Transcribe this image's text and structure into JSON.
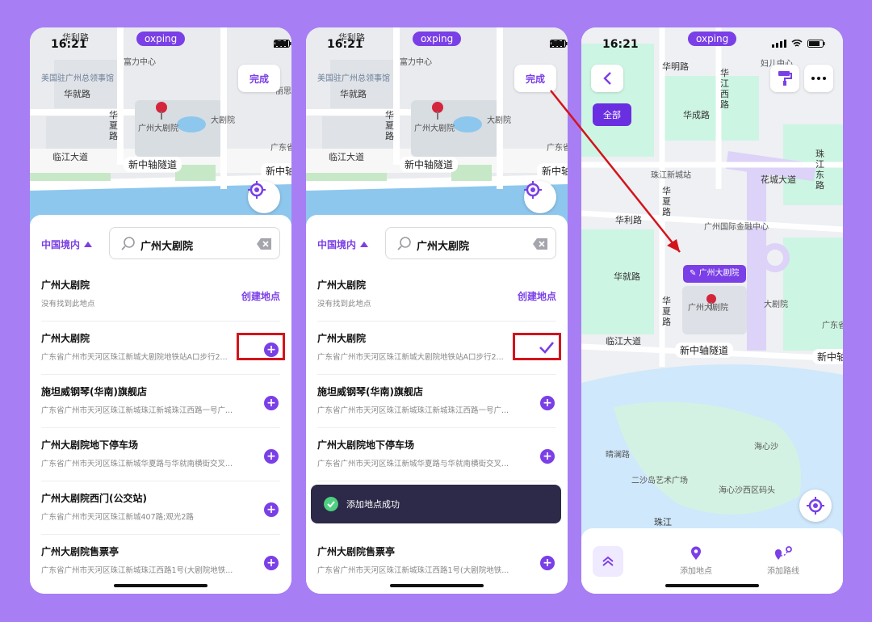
{
  "colors": {
    "accent": "#7a3fe6",
    "background": "#a87ef5",
    "highlight": "#d3141c",
    "success": "#4ed081"
  },
  "status": {
    "time": "16:21",
    "brand": "oxping"
  },
  "map": {
    "labels": [
      "华利路",
      "富力中心",
      "美国驻广州总领事馆",
      "华就路",
      "华夏路",
      "广州大剧院",
      "大剧院",
      "临江大道",
      "新中轴隧道",
      "新中轴",
      "广东省",
      "广东省",
      "丽思",
      "广州国际金融中心"
    ]
  },
  "screen1": {
    "done_label": "完成",
    "region_label": "中国境内",
    "search_value": "广州大剧院",
    "create_label": "创建地点",
    "results": [
      {
        "title": "广州大剧院",
        "subtitle": "没有找到此地点"
      },
      {
        "title": "广州大剧院",
        "subtitle": "广东省广州市天河区珠江新城大剧院地铁站A口步行2..."
      },
      {
        "title": "施坦威钢琴(华南)旗舰店",
        "subtitle": "广东省广州市天河区珠江新城珠江新城珠江西路一号广..."
      },
      {
        "title": "广州大剧院地下停车场",
        "subtitle": "广东省广州市天河区珠江新城华夏路与华就南横街交叉..."
      },
      {
        "title": "广州大剧院西门(公交站)",
        "subtitle": "广东省广州市天河区珠江新城407路;观光2路"
      },
      {
        "title": "广州大剧院售票亭",
        "subtitle": "广东省广州市天河区珠江新城珠江西路1号(大剧院地铁..."
      }
    ]
  },
  "screen2": {
    "toast": "添加地点成功",
    "toast_under": "广州大剧院西门(公交站)"
  },
  "screen3": {
    "all_label": "全部",
    "tag_label": "广州大剧院",
    "add_place": "添加地点",
    "add_route": "添加路线",
    "labels": [
      "妇儿中心",
      "华明路",
      "华江西路",
      "华成路",
      "珠江新城站",
      "华夏路",
      "花城大道",
      "珠江东路",
      "花",
      "华利路",
      "华就路",
      "广州国际金融中心",
      "广州大剧院",
      "大剧院",
      "华夏路",
      "临江大道",
      "新中轴隧道",
      "新中轴",
      "广东省",
      "广东省",
      "海心沙",
      "晴澜路",
      "二沙岛艺术广场",
      "海心沙西区码头",
      "珠江"
    ]
  }
}
